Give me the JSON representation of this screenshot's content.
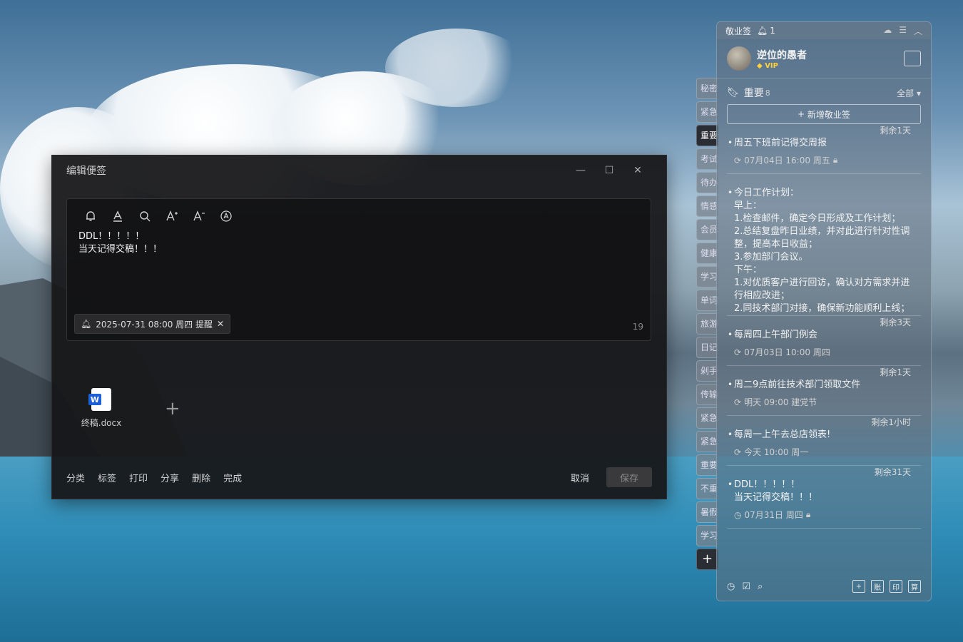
{
  "editor": {
    "title": "编辑便签",
    "controls": [
      "—",
      "☐",
      "✕"
    ],
    "note_lines": [
      "DDL！！！！！",
      "当天记得交稿！！！"
    ],
    "reminder": "2025-07-31 08:00 周四 提醒",
    "char_count": "19",
    "attachment_name": "终稿.docx",
    "actions": [
      "分类",
      "标签",
      "打印",
      "分享",
      "删除",
      "完成"
    ],
    "cancel_label": "取消",
    "save_label": "保存"
  },
  "categories": [
    "秘密",
    "紧急",
    "重要",
    "考试",
    "待办",
    "情感",
    "会员",
    "健康",
    "学习",
    "单词",
    "旅游",
    "日记",
    "剁手",
    "传输",
    "紧急",
    "紧急",
    "重要",
    "不重",
    "暑假",
    "学习"
  ],
  "active_category": "重要",
  "panel": {
    "app_name": "敬业签",
    "bell_count": "1",
    "user_name": "逆位的愚者",
    "vip_label": "VIP",
    "section_title": "重要",
    "section_count": "8",
    "filter_label": "全部",
    "new_note_label": "新增敬业签",
    "notes": [
      {
        "remain": "剩余1天",
        "text": "周五下班前记得交周报",
        "meta": "07月04日 16:00 周五"
      },
      {
        "remain": "",
        "text": "今日工作计划：\n早上：\n1.检查邮件，确定今日形成及工作计划；\n2.总结复盘昨日业绩，并对此进行针对性调整，提高本日收益；\n3.参加部门会议。\n下午：\n1.对优质客户进行回访，确认对方需求并进行相应改进；\n2.同技术部门对接，确保新功能顺利上线；",
        "meta": ""
      },
      {
        "remain": "剩余3天",
        "text": "每周四上午部门例会",
        "meta": "07月03日 10:00 周四"
      },
      {
        "remain": "剩余1天",
        "text": "周二9点前往技术部门领取文件",
        "meta": "明天 09:00 建党节"
      },
      {
        "remain": "剩余1小时",
        "text": "每周一上午去总店领表!",
        "meta": "今天 10:00 周一"
      },
      {
        "remain": "剩余31天",
        "text": "DDL！！！！！\n当天记得交稿！！！",
        "meta": "07月31日 周四"
      }
    ],
    "bottom_right": [
      "+",
      "账",
      "印",
      "算"
    ]
  }
}
